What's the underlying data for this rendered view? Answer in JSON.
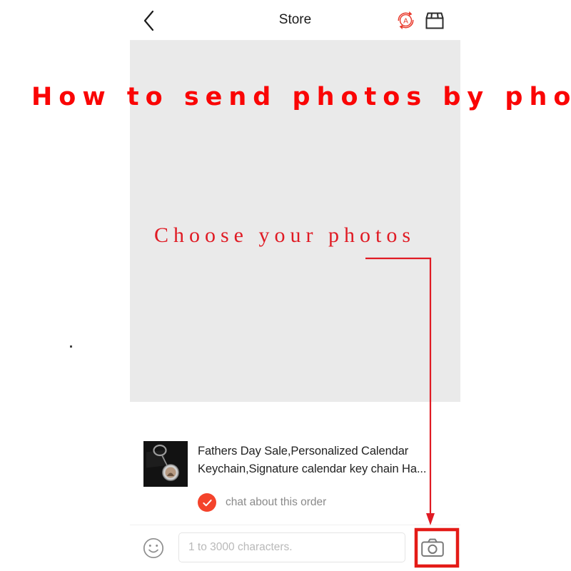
{
  "header": {
    "title": "Store",
    "back_icon": "chevron-left-icon",
    "translate_icon": "auto-translate-icon",
    "store_icon": "storefront-icon"
  },
  "photo_area": {
    "state": "empty-photo-picker"
  },
  "product": {
    "title": "Fathers Day Sale,Personalized Calendar Keychain,Signature calendar key chain Ha...",
    "thumbnail_alt": "keychain-product-photo",
    "chat_order_label": "chat about this order",
    "check_icon": "check-circle-icon"
  },
  "input_bar": {
    "emoji_icon": "smiley-face-icon",
    "message_value": "",
    "message_placeholder": "1 to 3000 characters.",
    "camera_icon": "camera-icon"
  },
  "annotations": {
    "tutorial_title": "How to send photos by phone",
    "choose_photos": "Choose your photos",
    "arrow_color": "#e01b24",
    "highlight_color": "#e41b17",
    "title_color": "#fa0505"
  }
}
